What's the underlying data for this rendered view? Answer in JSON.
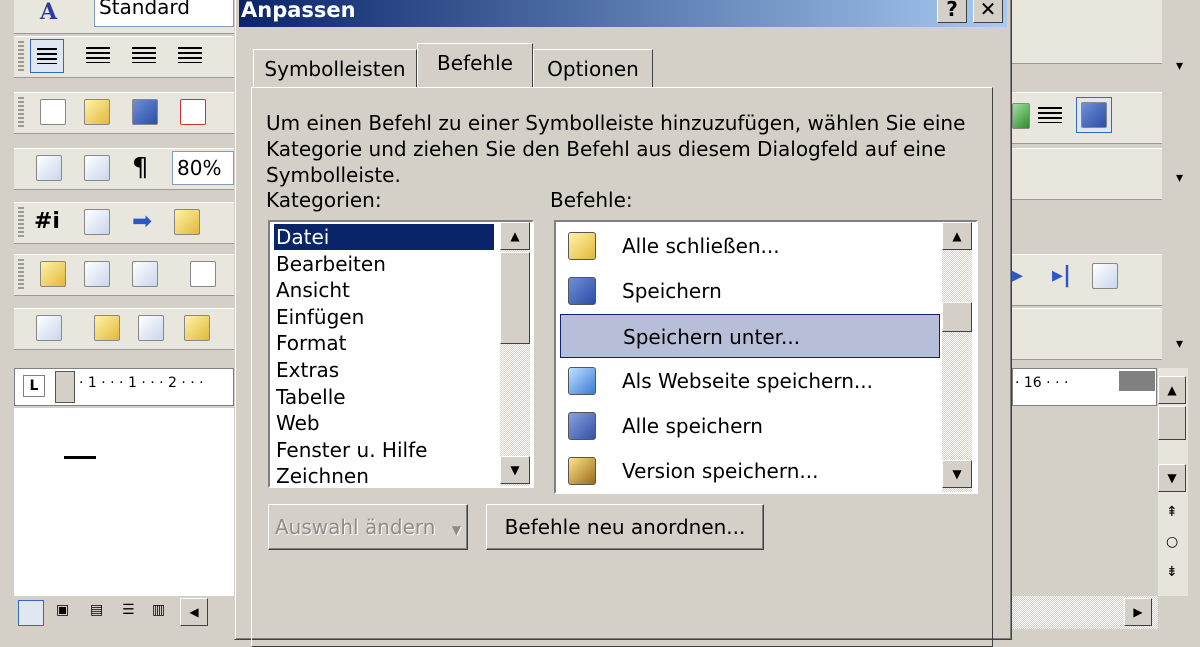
{
  "background": {
    "style_box": "Standard",
    "zoom": "80%",
    "ruler_left": "· 1 · · · 1 · · · 2 · · ·",
    "ruler_right": "· 16 · · ·"
  },
  "dialog": {
    "title": "Anpassen",
    "help_btn": "?",
    "close_btn": "✕",
    "tabs": [
      {
        "label": "Symbolleisten"
      },
      {
        "label": "Befehle"
      },
      {
        "label": "Optionen"
      }
    ],
    "description": [
      "Um einen Befehl zu einer Symbolleiste hinzuzufügen, wählen Sie eine",
      "Kategorie und ziehen Sie den Befehl aus diesem Dialogfeld auf eine",
      "Symbolleiste."
    ],
    "categories_label": "Kategorien:",
    "commands_label": "Befehle:",
    "categories": [
      "Datei",
      "Bearbeiten",
      "Ansicht",
      "Einfügen",
      "Format",
      "Extras",
      "Tabelle",
      "Web",
      "Fenster u. Hilfe",
      "Zeichnen"
    ],
    "commands": [
      {
        "label": "Alle schließen...",
        "icon": "folder-icon"
      },
      {
        "label": "Speichern",
        "icon": "save-icon"
      },
      {
        "label": "Speichern unter...",
        "icon": ""
      },
      {
        "label": "Als Webseite speichern...",
        "icon": "web-save-icon"
      },
      {
        "label": "Alle speichern",
        "icon": "save-all-icon"
      },
      {
        "label": "Version speichern...",
        "icon": "version-icon"
      }
    ],
    "modify_selection_btn": "Auswahl ändern",
    "rearrange_btn": "Befehle neu anordnen..."
  },
  "colors": {
    "title_start": "#0a246a",
    "title_end": "#a6caf0",
    "selection": "#0a246a",
    "command_highlight": "#b7bed8"
  }
}
